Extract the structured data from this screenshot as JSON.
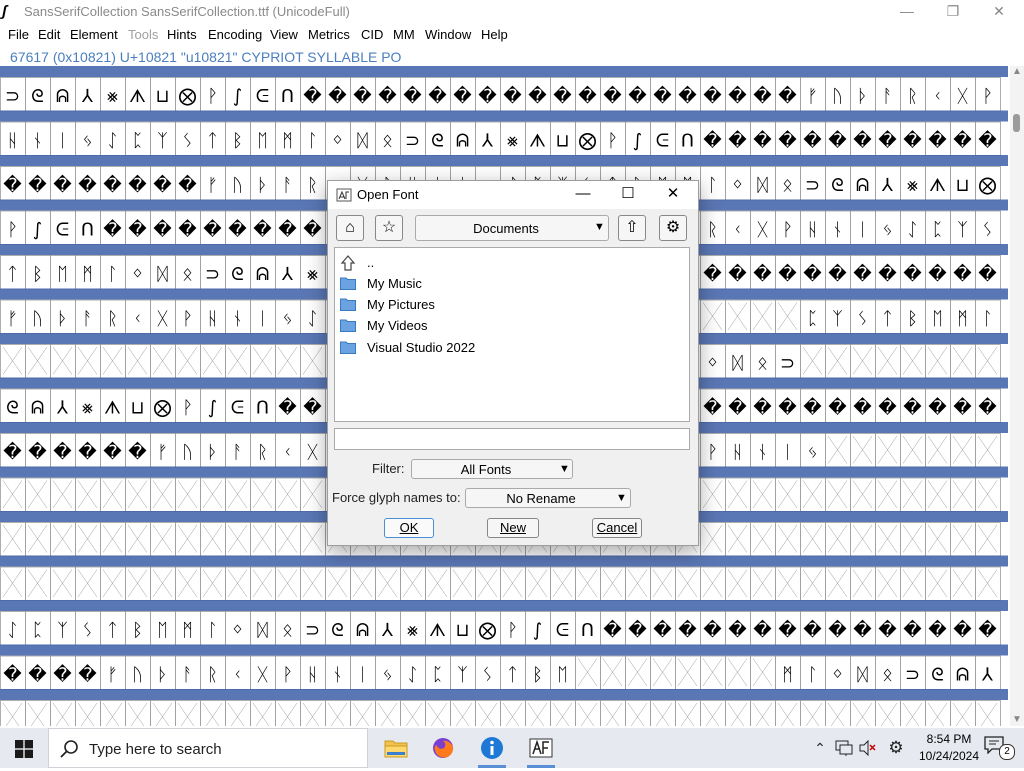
{
  "window": {
    "title": "SansSerifCollection  SansSerifCollection.ttf (UnicodeFull)",
    "minimize_icon": "—",
    "restore_icon": "❐",
    "close_icon": "✕"
  },
  "menu": [
    {
      "label": "File",
      "enabled": true
    },
    {
      "label": "Edit",
      "enabled": true
    },
    {
      "label": "Element",
      "enabled": true
    },
    {
      "label": "Tools",
      "enabled": false
    },
    {
      "label": "Hints",
      "enabled": true
    },
    {
      "label": "Encoding",
      "enabled": true
    },
    {
      "label": "View",
      "enabled": true
    },
    {
      "label": "Metrics",
      "enabled": true
    },
    {
      "label": "CID",
      "enabled": true
    },
    {
      "label": "MM",
      "enabled": true
    },
    {
      "label": "Window",
      "enabled": true
    },
    {
      "label": "Help",
      "enabled": true
    }
  ],
  "glyph_info": "67617 (0x10821) U+10821 \"u10821\" CYPRIOT SYLLABLE PO",
  "colors": {
    "accent": "#4a7fbf",
    "glyph_label_band": "#3d5fa8",
    "grid_line": "#8c8c8c",
    "empty_cross": "#9a9a9a",
    "folder": "#4f8fd6",
    "taskbar": "#e6eaf0"
  },
  "dialog": {
    "title": "Open Font",
    "minimize_icon": "—",
    "maximize_icon": "☐",
    "close_icon": "✕",
    "home_icon": "⌂",
    "bookmark_icon": "☆",
    "up_icon": "⇧",
    "settings_icon": "⚙",
    "directory": "Documents",
    "files": [
      {
        "label": "..",
        "icon": "up-arrow-icon"
      },
      {
        "label": "My Music",
        "icon": "folder-icon"
      },
      {
        "label": "My Pictures",
        "icon": "folder-icon"
      },
      {
        "label": "My Videos",
        "icon": "folder-icon"
      },
      {
        "label": "Visual Studio 2022",
        "icon": "folder-icon"
      }
    ],
    "filename_value": "",
    "filter_label": "Filter:",
    "filter_value": "All Fonts",
    "force_label": "Force glyph names to:",
    "force_value": "No Rename",
    "ok_label": "OK",
    "new_label": "New",
    "cancel_label": "Cancel"
  },
  "taskbar": {
    "search_placeholder": "Type here to search",
    "apps": [
      "file-explorer-icon",
      "firefox-icon",
      "info-app-icon",
      "fontforge-icon"
    ],
    "time": "8:54 PM",
    "date": "10/24/2024",
    "notification_count": "2"
  }
}
